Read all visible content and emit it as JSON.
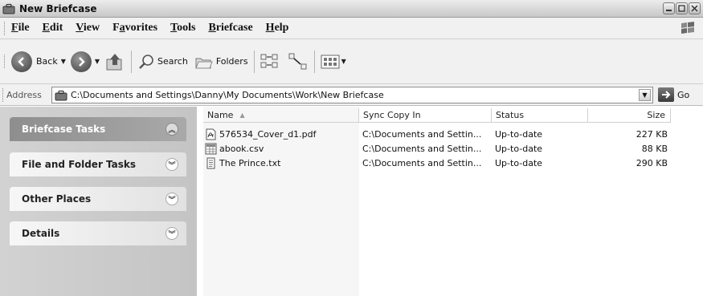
{
  "window": {
    "title": "New Briefcase"
  },
  "menu": {
    "items": [
      {
        "pre": "",
        "u": "F",
        "post": "ile"
      },
      {
        "pre": "",
        "u": "E",
        "post": "dit"
      },
      {
        "pre": "",
        "u": "V",
        "post": "iew"
      },
      {
        "pre": "F",
        "u": "a",
        "post": "vorites"
      },
      {
        "pre": "",
        "u": "T",
        "post": "ools"
      },
      {
        "pre": "",
        "u": "B",
        "post": "riefcase"
      },
      {
        "pre": "",
        "u": "H",
        "post": "elp"
      }
    ]
  },
  "toolbar": {
    "back_label": "Back",
    "search_label": "Search",
    "folders_label": "Folders"
  },
  "address": {
    "label": "Address",
    "path": "C:\\Documents and Settings\\Danny\\My Documents\\Work\\New Briefcase",
    "go_label": "Go"
  },
  "tasks": {
    "panels": [
      {
        "title": "Briefcase Tasks",
        "expanded": true
      },
      {
        "title": "File and Folder Tasks"
      },
      {
        "title": "Other Places"
      },
      {
        "title": "Details"
      }
    ]
  },
  "files": {
    "columns": [
      "Name",
      "Sync Copy In",
      "Status",
      "Size"
    ],
    "sort_glyph": "▲",
    "rows": [
      {
        "icon": "pdf-file-icon",
        "name": "576534_Cover_d1.pdf",
        "sync": "C:\\Documents and Settin...",
        "status": "Up-to-date",
        "size": "227 KB"
      },
      {
        "icon": "csv-file-icon",
        "name": "abook.csv",
        "sync": "C:\\Documents and Settin...",
        "status": "Up-to-date",
        "size": "88 KB"
      },
      {
        "icon": "text-file-icon",
        "name": "The Prince.txt",
        "sync": "C:\\Documents and Settin...",
        "status": "Up-to-date",
        "size": "290 KB"
      }
    ]
  },
  "colors": {
    "taskpane": "#c8c8c8",
    "panel_header_dark": "#9a9a9a",
    "panel_header_light": "#f0f0f0"
  }
}
